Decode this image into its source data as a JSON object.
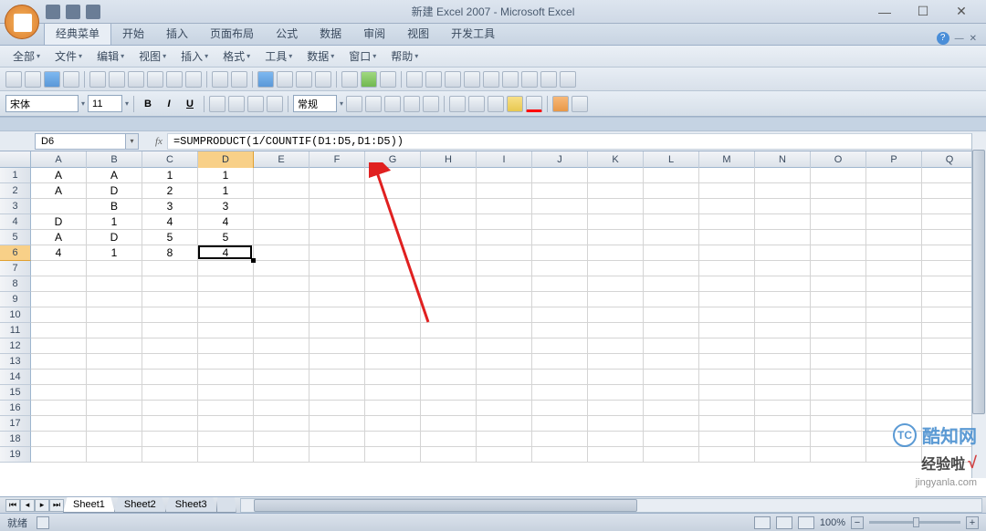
{
  "title": "新建 Excel 2007 - Microsoft Excel",
  "win_controls": {
    "minimize": "—",
    "maximize": "☐",
    "close": "✕"
  },
  "ribbon_tabs": [
    "经典菜单",
    "开始",
    "插入",
    "页面布局",
    "公式",
    "数据",
    "审阅",
    "视图",
    "开发工具"
  ],
  "menus": [
    "全部",
    "文件",
    "编辑",
    "视图",
    "插入",
    "格式",
    "工具",
    "数据",
    "窗口",
    "帮助"
  ],
  "format": {
    "font_name": "宋体",
    "font_size": "11",
    "bold": "B",
    "italic": "I",
    "underline": "U",
    "number_format": "常规"
  },
  "formula_bar": {
    "name_box": "D6",
    "fx": "fx",
    "formula": "=SUMPRODUCT(1/COUNTIF(D1:D5,D1:D5))"
  },
  "columns": [
    "A",
    "B",
    "C",
    "D",
    "E",
    "F",
    "G",
    "H",
    "I",
    "J",
    "K",
    "L",
    "M",
    "N",
    "O",
    "P",
    "Q"
  ],
  "selected_col": "D",
  "selected_row": 6,
  "row_count": 19,
  "cells": {
    "1": {
      "A": "A",
      "B": "A",
      "C": "1",
      "D": "1"
    },
    "2": {
      "A": "A",
      "B": "D",
      "C": "2",
      "D": "1"
    },
    "3": {
      "A": "",
      "B": "B",
      "C": "3",
      "D": "3"
    },
    "4": {
      "A": "D",
      "B": "1",
      "C": "4",
      "D": "4"
    },
    "5": {
      "A": "A",
      "B": "D",
      "C": "5",
      "D": "5"
    },
    "6": {
      "A": "4",
      "B": "1",
      "C": "8",
      "D": "4"
    }
  },
  "sheets": [
    "Sheet1",
    "Sheet2",
    "Sheet3"
  ],
  "status": {
    "ready": "就绪",
    "zoom": "100%",
    "zoom_minus": "−",
    "zoom_plus": "+"
  },
  "watermark": {
    "logo1_icon": "TC",
    "logo1_text": "酷知网",
    "logo2_text": "经验啦",
    "logo2_check": "√",
    "logo2_url": "jingyanla.com"
  }
}
